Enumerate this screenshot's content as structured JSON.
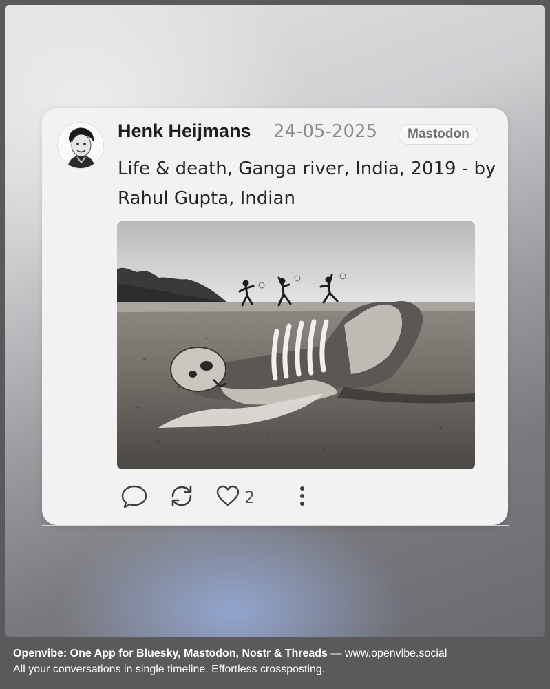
{
  "post": {
    "author": "Henk Heijmans",
    "date": "24-05-2025",
    "network": "Mastodon",
    "text": "Life & death, Ganga river, India, 2019 - by Rahul Gupta, Indian",
    "likes": "2"
  },
  "icons": {
    "reply": "speech-bubble-icon",
    "repost": "repost-arrows-icon",
    "like": "heart-icon",
    "more": "vertical-ellipsis-icon"
  },
  "footer": {
    "title": "Openvibe: One App for Bluesky, Mastodon, Nostr & Threads",
    "separator": " — ",
    "url": "www.openvibe.social",
    "tagline": "All your conversations in single timeline. Effortless crossposting."
  },
  "colors": {
    "card": "#f2f2f3",
    "text": "#262626",
    "muted": "#8c8c8c",
    "footer_bg": "#5a5a5c"
  }
}
